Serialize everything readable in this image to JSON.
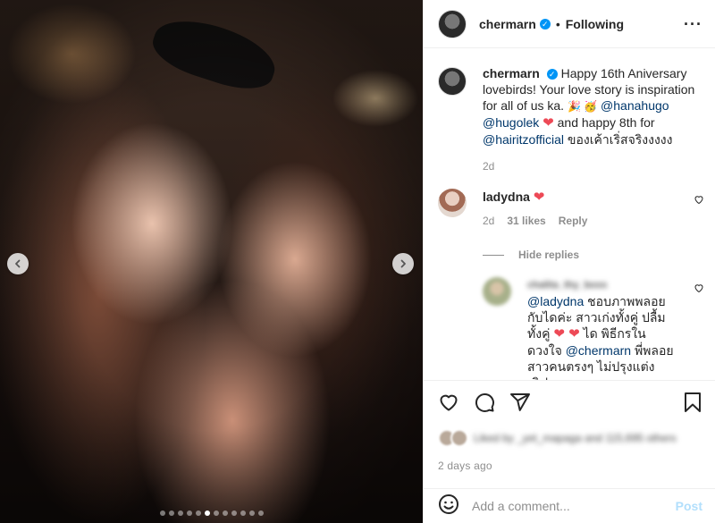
{
  "post": {
    "username": "chermarn",
    "follow_status": "Following",
    "separator": "•",
    "more_icon": "more-horizontal-icon",
    "image": {
      "slide_count": 12,
      "active_slide": 5
    }
  },
  "caption": {
    "username": "chermarn",
    "text_1": "Happy 16th Aniversary lovebirds! Your love story is inspiration for all of us ka.",
    "emojis": "🎉 🥳",
    "mention_1": "@hanahugo",
    "mention_2": "@hugolek",
    "heart": "❤",
    "text_2": "and happy 8th for",
    "mention_3": "@hairitzofficial",
    "text_3": "ของเค้าเริ่สจริงงงงง",
    "time": "2d"
  },
  "comments": [
    {
      "username": "ladydna",
      "heart": "❤",
      "time": "2d",
      "likes": "31 likes",
      "reply_label": "Reply",
      "hide_replies": "Hide replies",
      "replies": [
        {
          "username_blurred": "chalita_thy_boss",
          "mention_1": "@ladydna",
          "text_1": "ชอบภาพพลอยกับไดค่ะ สาวเก่งทั้งคู่ ปลื้มทั้งคู่",
          "hearts": "❤ ❤",
          "text_2": "ได พิธีกรในดวงใจ",
          "mention_2": "@chermarn",
          "text_3": "พี่พลอย สาวคนตรงๆ ไม่ปรุงแต่ง เลิฟๆ"
        }
      ]
    }
  ],
  "actions": {
    "like_icon": "heart-icon",
    "comment_icon": "comment-icon",
    "share_icon": "share-icon",
    "save_icon": "bookmark-icon",
    "likes_blurred": "Liked by _yet_mapaga and 115,695 others",
    "post_time": "2 days ago"
  },
  "add_comment": {
    "placeholder": "Add a comment...",
    "post_label": "Post"
  },
  "colors": {
    "link": "#00376b",
    "verified": "#0095f6",
    "heart": "#ed4956",
    "muted": "#8e8e8e",
    "post_disabled": "#b2dffc"
  }
}
